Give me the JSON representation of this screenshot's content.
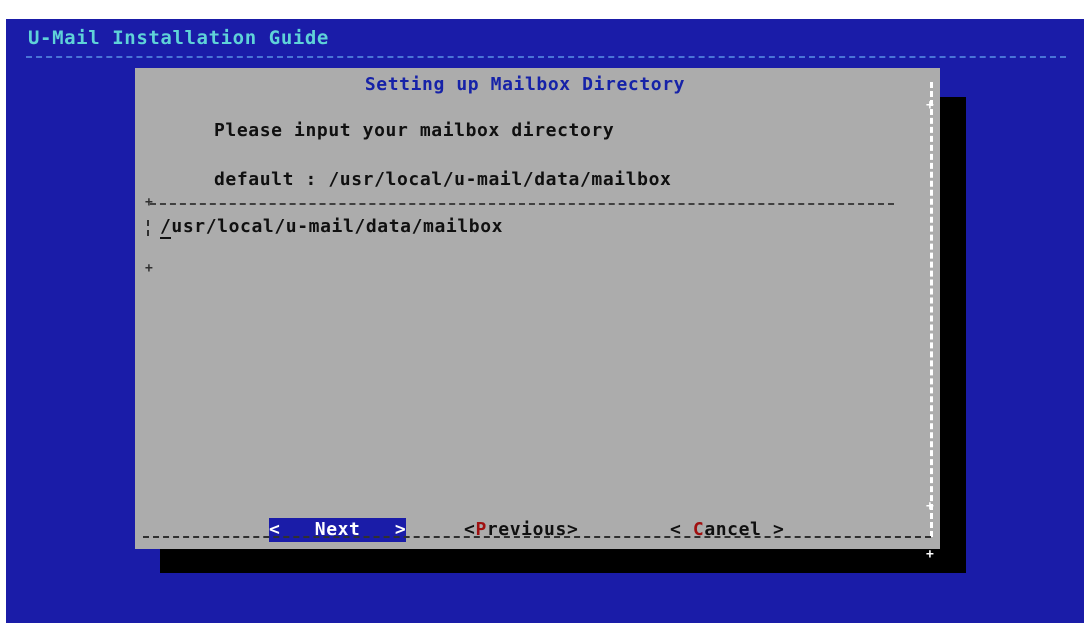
{
  "screen": {
    "backtitle": "U-Mail Installation Guide",
    "background_color": "#1a1ca8"
  },
  "dialog": {
    "title": "Setting up Mailbox Directory",
    "prompt": "Please input your mailbox directory",
    "default_line": "default : /usr/local/u-mail/data/mailbox",
    "input_value": "/usr/local/u-mail/data/mailbox",
    "background_color": "#acacac"
  },
  "buttons": {
    "next": {
      "left": "<",
      "hotkey": "N",
      "rest": "ext",
      "right": ">"
    },
    "previous": {
      "left": "<",
      "hotkey": "P",
      "rest": "revious",
      "right": ">"
    },
    "cancel": {
      "left": "<",
      "hotkey": "C",
      "rest": "ancel",
      "right": ">"
    }
  },
  "colors": {
    "title_text": "#1622a8",
    "hotkey": "#a01010",
    "selected_button_bg": "#1a1ca8"
  }
}
